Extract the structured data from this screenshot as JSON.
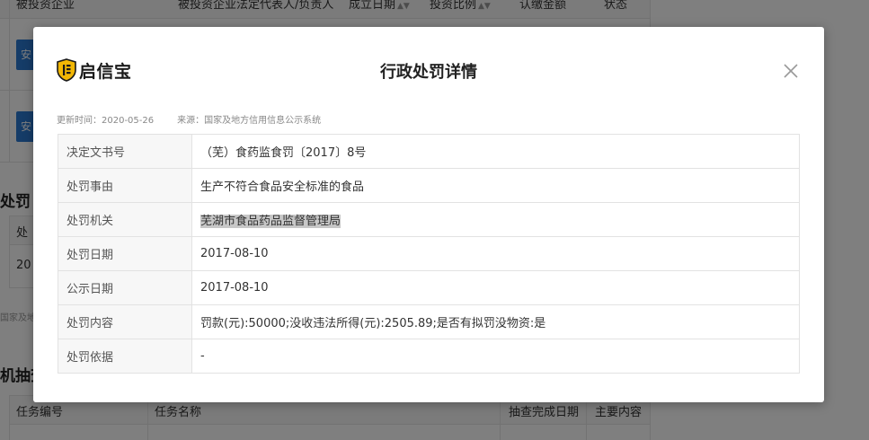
{
  "background": {
    "top_table_headers": [
      "被投资企业",
      "被投资企业法定代表人/负责人",
      "成立日期",
      "投资比例",
      "认缴金额",
      "状态"
    ],
    "buttons": [
      "安",
      "安"
    ],
    "section_penalty_title": "处罚",
    "penalty_col_partial": "处",
    "penalty_year_partial": "20",
    "source_partial": "国家及地",
    "section_random_check_title": "机抽查",
    "bottom_table_headers": [
      "任务编号",
      "任务名称",
      "抽查完成日期",
      "主要内容"
    ]
  },
  "modal": {
    "logo_text": "启信宝",
    "title": "行政处罚详情",
    "update_time": "更新时间：2020-05-26",
    "source": "来源：国家及地方信用信息公示系统",
    "rows": [
      {
        "label": "决定文书号",
        "value": "（芜）食药监食罚〔2017〕8号"
      },
      {
        "label": "处罚事由",
        "value": "生产不符合食品安全标准的食品"
      },
      {
        "label": "处罚机关",
        "value": "芜湖市食品药品监督管理局"
      },
      {
        "label": "处罚日期",
        "value": "2017-08-10"
      },
      {
        "label": "公示日期",
        "value": "2017-08-10"
      },
      {
        "label": "处罚内容",
        "value": "罚款(元):50000;没收违法所得(元):2505.89;是否有拟罚没物资:是"
      },
      {
        "label": "处罚依据",
        "value": "-"
      }
    ]
  },
  "colors": {
    "overlay": "#000000",
    "logo_gold": "#f2b705",
    "logo_dark": "#1a1a1a",
    "button_blue": "#2b79d0"
  },
  "icons": {
    "logo": "shield-logo-icon",
    "close": "close-icon",
    "sort": "sort-caret-icon"
  }
}
